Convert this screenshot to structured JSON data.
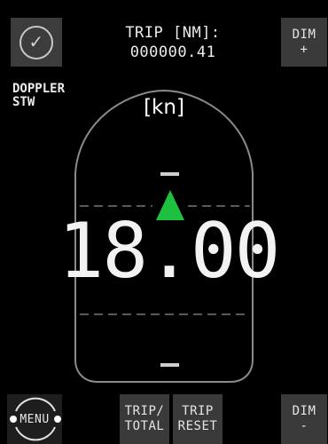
{
  "top_bar": {
    "trip_label": "TRIP [NM]:",
    "trip_value": "000000.41",
    "dim_plus_label": "DIM",
    "dim_plus_sign": "+"
  },
  "display": {
    "source_line1": "DOPPLER",
    "source_line2": "STW",
    "unit": "[kn]",
    "speed": "18.00",
    "direction_color": "#1fbf3f"
  },
  "bottom_bar": {
    "menu_label": "MENU",
    "trip_total_line1": "TRIP/",
    "trip_total_line2": "TOTAL",
    "trip_reset_line1": "TRIP",
    "trip_reset_line2": "RESET",
    "dim_minus_label": "DIM",
    "dim_minus_sign": "-"
  }
}
